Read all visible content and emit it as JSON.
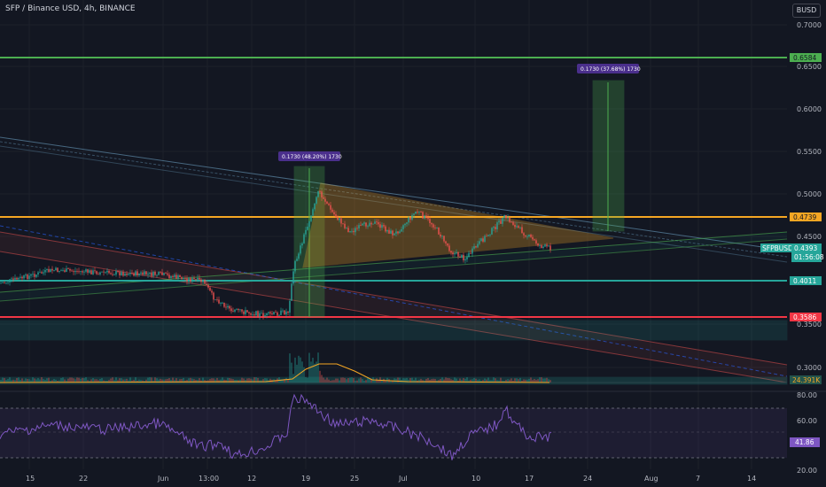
{
  "header": {
    "symbol_title": "SFP / Binance USD, 4h, BINANCE",
    "currency_button": "BUSD"
  },
  "price_axis": {
    "ticks": [
      "0.7000",
      "0.6500",
      "0.6000",
      "0.5500",
      "0.5000",
      "0.4500",
      "0.3500",
      "0.3000"
    ],
    "tag_green_top": "0.6584",
    "tag_orange": "0.4739",
    "tag_symbol": "SFPBUSD",
    "tag_price": "0.4393",
    "tag_countdown": "01:56:08",
    "tag_teal": "0.4011",
    "tag_red": "0.3586",
    "tag_volume": "24.391K"
  },
  "rsi_axis": {
    "ticks": [
      "80.00",
      "60.00",
      "20.00"
    ],
    "value_tag": "41.86"
  },
  "time_axis": {
    "labels": [
      "15",
      "22",
      "Jun",
      "13:00",
      "12",
      "19",
      "25",
      "Jul",
      "10",
      "17",
      "24",
      "Aug",
      "7",
      "14"
    ]
  },
  "measurements": {
    "left": "0.1730 (48.20%) 1730",
    "right": "0.1730 (37.68%) 1730"
  },
  "colors": {
    "background": "#131722",
    "grid": "#1e222d",
    "up": "#26a69a",
    "down": "#ef5350",
    "green_line": "#4caf50",
    "orange_line": "#f5a623",
    "teal_line": "#26a69a",
    "red_line": "#f23645",
    "rsi_line": "#7e57c2",
    "measure_label": "#4a2f8c"
  }
}
